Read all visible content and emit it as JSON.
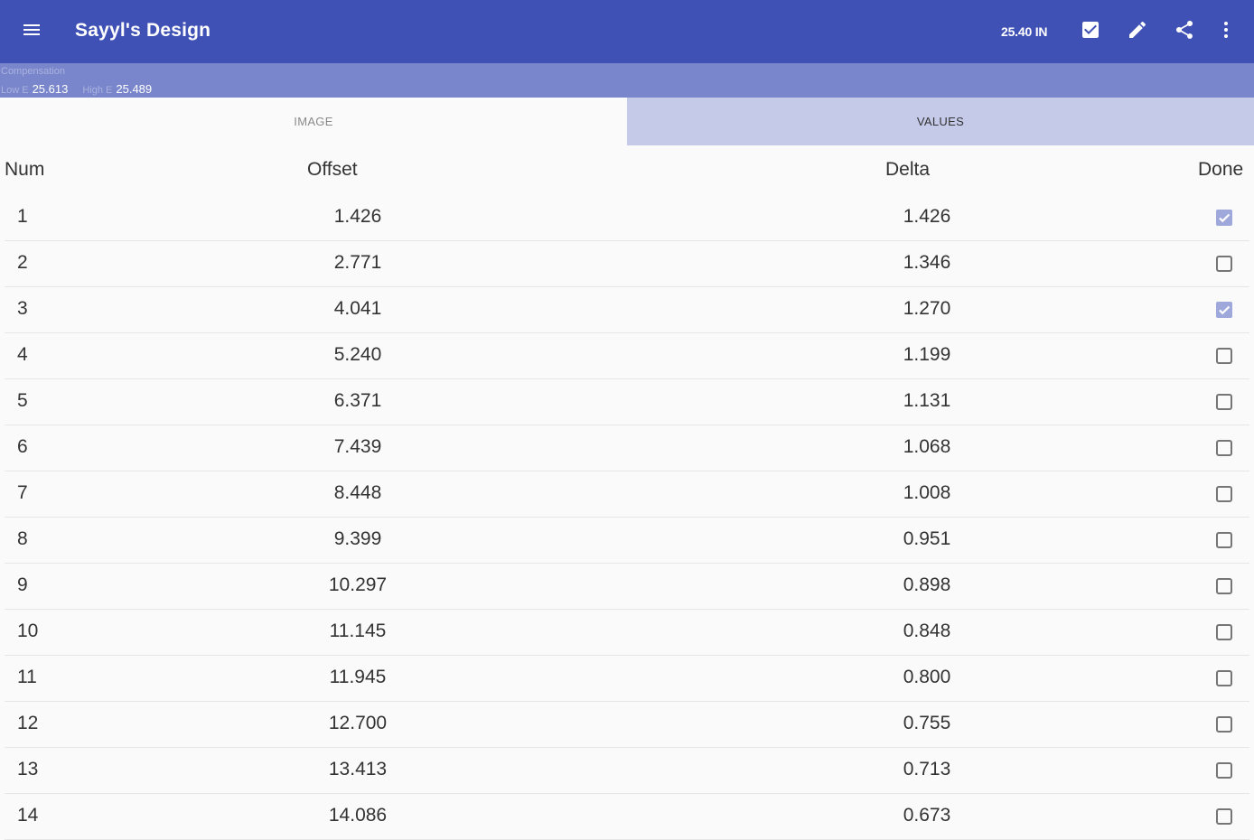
{
  "appbar": {
    "title": "Sayyl's Design",
    "measurement": "25.40 IN",
    "icons": [
      "menu-icon",
      "check-box-icon",
      "pencil-icon",
      "share-icon",
      "more-vert-icon"
    ]
  },
  "compensation": {
    "label": "Compensation",
    "low_label": "Low E",
    "low_value": "25.613",
    "high_label": "High E",
    "high_value": "25.489"
  },
  "tabs": [
    {
      "label": "IMAGE",
      "active": false
    },
    {
      "label": "VALUES",
      "active": true
    }
  ],
  "table": {
    "headers": {
      "num": "Num",
      "offset": "Offset",
      "delta": "Delta",
      "done": "Done"
    },
    "rows": [
      {
        "num": "1",
        "offset": "1.426",
        "delta": "1.426",
        "done": true
      },
      {
        "num": "2",
        "offset": "2.771",
        "delta": "1.346",
        "done": false
      },
      {
        "num": "3",
        "offset": "4.041",
        "delta": "1.270",
        "done": true
      },
      {
        "num": "4",
        "offset": "5.240",
        "delta": "1.199",
        "done": false
      },
      {
        "num": "5",
        "offset": "6.371",
        "delta": "1.131",
        "done": false
      },
      {
        "num": "6",
        "offset": "7.439",
        "delta": "1.068",
        "done": false
      },
      {
        "num": "7",
        "offset": "8.448",
        "delta": "1.008",
        "done": false
      },
      {
        "num": "8",
        "offset": "9.399",
        "delta": "0.951",
        "done": false
      },
      {
        "num": "9",
        "offset": "10.297",
        "delta": "0.898",
        "done": false
      },
      {
        "num": "10",
        "offset": "11.145",
        "delta": "0.848",
        "done": false
      },
      {
        "num": "11",
        "offset": "11.945",
        "delta": "0.800",
        "done": false
      },
      {
        "num": "12",
        "offset": "12.700",
        "delta": "0.755",
        "done": false
      },
      {
        "num": "13",
        "offset": "13.413",
        "delta": "0.713",
        "done": false
      },
      {
        "num": "14",
        "offset": "14.086",
        "delta": "0.673",
        "done": false
      }
    ]
  },
  "colors": {
    "primary": "#3f51b5",
    "compensation_bar": "#7986cb",
    "active_tab": "#c5cae9",
    "checked": "#9fa8da",
    "unchecked": "#757575"
  }
}
